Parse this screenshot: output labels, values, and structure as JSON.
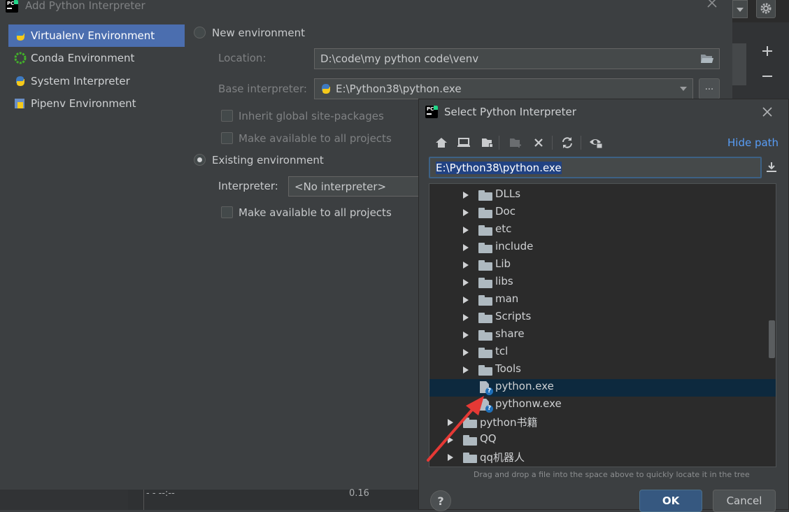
{
  "main_dialog": {
    "title": "Add Python Interpreter",
    "sidebar": [
      {
        "label": "Virtualenv Environment",
        "icon": "python-icon",
        "selected": true
      },
      {
        "label": "Conda Environment",
        "icon": "conda-icon",
        "selected": false
      },
      {
        "label": "System Interpreter",
        "icon": "python-icon",
        "selected": false
      },
      {
        "label": "Pipenv Environment",
        "icon": "pipenv-icon",
        "selected": false
      }
    ],
    "new_env": {
      "radio_label": "New environment",
      "location_label": "Location:",
      "location_value": "D:\\code\\my python code\\venv",
      "base_label": "Base interpreter:",
      "base_value": "E:\\Python38\\python.exe",
      "ellipsis": "...",
      "inherit_label": "Inherit global site-packages",
      "make_available_label": "Make available to all projects"
    },
    "existing_env": {
      "radio_label": "Existing environment",
      "interpreter_label": "Interpreter:",
      "interpreter_value": "<No interpreter>",
      "make_available_label": "Make available to all projects"
    },
    "bottom_partial": {
      "left": "- - --:--",
      "right": "0.16"
    }
  },
  "select_dialog": {
    "title": "Select Python Interpreter",
    "hide_path": "Hide path",
    "path_value": "E:\\Python38\\python.exe",
    "tree": [
      {
        "label": "DLLs",
        "type": "folder",
        "level": 1
      },
      {
        "label": "Doc",
        "type": "folder",
        "level": 1
      },
      {
        "label": "etc",
        "type": "folder",
        "level": 1
      },
      {
        "label": "include",
        "type": "folder",
        "level": 1
      },
      {
        "label": "Lib",
        "type": "folder",
        "level": 1
      },
      {
        "label": "libs",
        "type": "folder",
        "level": 1
      },
      {
        "label": "man",
        "type": "folder",
        "level": 1
      },
      {
        "label": "Scripts",
        "type": "folder",
        "level": 1
      },
      {
        "label": "share",
        "type": "folder",
        "level": 1
      },
      {
        "label": "tcl",
        "type": "folder",
        "level": 1
      },
      {
        "label": "Tools",
        "type": "folder",
        "level": 1
      },
      {
        "label": "python.exe",
        "type": "file",
        "level": 1,
        "selected": true
      },
      {
        "label": "pythonw.exe",
        "type": "file",
        "level": 1
      },
      {
        "label": "python书籍",
        "type": "folder",
        "level": 0
      },
      {
        "label": "QQ",
        "type": "folder",
        "level": 0
      },
      {
        "label": "qq机器人",
        "type": "folder",
        "level": 0
      }
    ],
    "hint": "Drag and drop a file into the space above to quickly locate it in the tree",
    "help": "?",
    "ok": "OK",
    "cancel": "Cancel"
  },
  "colors": {
    "accent": "#4b6eaf",
    "ok_button": "#365880",
    "link": "#589df6",
    "arrow": "#e53935"
  }
}
